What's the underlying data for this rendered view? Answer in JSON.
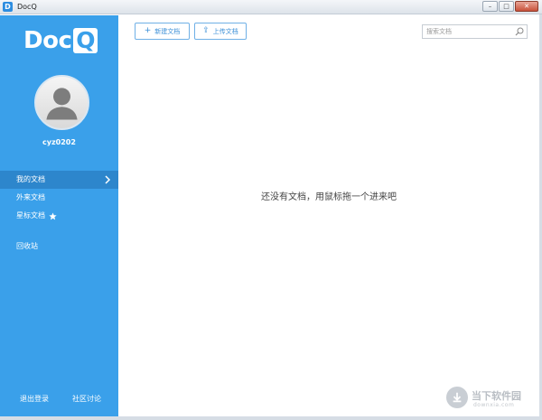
{
  "window": {
    "title": "DocQ",
    "icon_letter": "D",
    "minimize": "–",
    "maximize": "□",
    "close": "✕"
  },
  "sidebar": {
    "logo_text": "Doc",
    "logo_q": "Q",
    "username": "cyz0202",
    "items": [
      {
        "label": "我的文档"
      },
      {
        "label": "外来文档"
      },
      {
        "label": "星标文档"
      },
      {
        "label": "回收站"
      }
    ],
    "logout_label": "退出登录",
    "community_label": "社区讨论"
  },
  "toolbar": {
    "new_doc_icon": "+",
    "new_doc_label": "新建文档",
    "upload_icon": "⇪",
    "upload_label": "上传文档",
    "search_placeholder": "搜索文档"
  },
  "main": {
    "empty_message": "还没有文档，用鼠标拖一个进来吧"
  },
  "watermark": {
    "text": "当下软件园",
    "sub": "downxia.com"
  },
  "colors": {
    "sidebar": "#3aa0ea",
    "active_item": "#2d86cc",
    "button_border": "#6fb0e6",
    "button_text": "#3b8fd7"
  }
}
